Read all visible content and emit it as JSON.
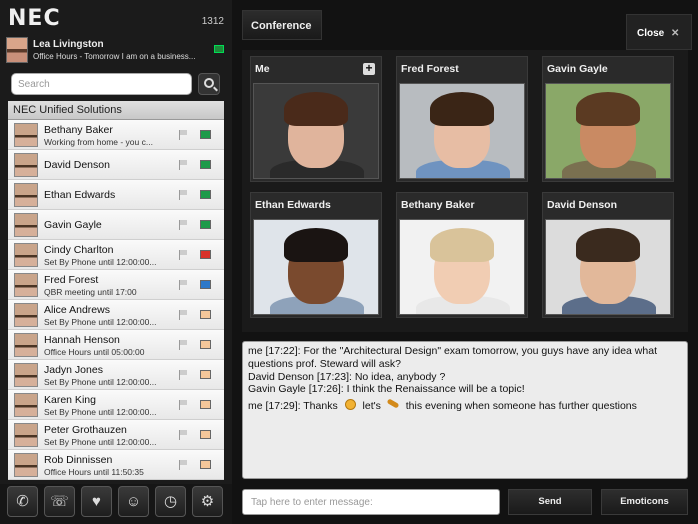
{
  "app": {
    "brand": "NEC",
    "extension": "1312"
  },
  "me": {
    "name": "Lea Livingston",
    "status": "Office Hours - Tomorrow I am on a business..."
  },
  "search": {
    "placeholder": "Search"
  },
  "group": {
    "name": "NEC Unified Solutions"
  },
  "contacts": [
    {
      "name": "Bethany Baker",
      "status": "Working from home - you c...",
      "presence": "#1e9a4a"
    },
    {
      "name": "David Denson",
      "status": "",
      "presence": "#1e9a4a"
    },
    {
      "name": "Ethan Edwards",
      "status": "",
      "presence": "#1e9a4a"
    },
    {
      "name": "Gavin Gayle",
      "status": "",
      "presence": "#1e9a4a"
    },
    {
      "name": "Cindy Charlton",
      "status": "Set By Phone until 12:00:00...",
      "presence": "#d8322a"
    },
    {
      "name": "Fred Forest",
      "status": "QBR meeting until 17:00",
      "presence": "#2d78c8"
    },
    {
      "name": "Alice Andrews",
      "status": "Set By Phone until 12:00:00...",
      "presence": "#f5c79a"
    },
    {
      "name": "Hannah Henson",
      "status": "Office Hours until 05:00:00",
      "presence": "#f5c79a"
    },
    {
      "name": "Jadyn Jones",
      "status": "Set By Phone until 12:00:00...",
      "presence": "#f5c79a"
    },
    {
      "name": "Karen King",
      "status": "Set By Phone until 12:00:00...",
      "presence": "#f5c79a"
    },
    {
      "name": "Peter Grothauzen",
      "status": "Set By Phone until 12:00:00...",
      "presence": "#f5c79a"
    },
    {
      "name": "Rob Dinnissen",
      "status": "Office Hours until 11:50:35",
      "presence": "#f5c79a"
    }
  ],
  "toolbar": {
    "icons": [
      "phone-icon",
      "call-transfer-icon",
      "favorites-icon",
      "contacts-icon",
      "clock-icon",
      "settings-icon"
    ]
  },
  "conference": {
    "tab_label": "Conference",
    "close_label": "Close",
    "participants": [
      {
        "name": "Me",
        "skin": "#e0b49c",
        "hair": "#4a2a1a",
        "shirt": "#2a2a2a",
        "bg": "#3a3a3a"
      },
      {
        "name": "Fred Forest",
        "skin": "#e7bda4",
        "hair": "#3a2516",
        "shirt": "#6f93c0",
        "bg": "#b8bcc0"
      },
      {
        "name": "Gavin Gayle",
        "skin": "#c98a63",
        "hair": "#5b3a22",
        "shirt": "#7a7050",
        "bg": "#8aa868"
      },
      {
        "name": "Ethan Edwards",
        "skin": "#7a4a2e",
        "hair": "#1a1412",
        "shirt": "#8ea2ba",
        "bg": "#dfe4ea"
      },
      {
        "name": "Bethany Baker",
        "skin": "#f1cdb3",
        "hair": "#d9c39a",
        "shirt": "#e8e8e8",
        "bg": "#f2f2f2"
      },
      {
        "name": "David Denson",
        "skin": "#e2b89a",
        "hair": "#3a2a1e",
        "shirt": "#5c6e8a",
        "bg": "#dcdcdc"
      }
    ]
  },
  "chat": {
    "messages": [
      "me [17:22]: For the \"Architectural Design\" exam tomorrow, you guys have any idea what questions prof. Steward will ask?",
      "David Denson [17:23]: No idea, anybody ?",
      "Gavin Gayle [17:26]: I think the Renaissance will be a topic!"
    ],
    "last_prefix": "me [17:29]: Thanks",
    "last_mid": "let's",
    "last_suffix": "this evening when someone has further questions"
  },
  "composer": {
    "placeholder": "Tap here to enter message:",
    "send_label": "Send",
    "emoticons_label": "Emoticons"
  }
}
